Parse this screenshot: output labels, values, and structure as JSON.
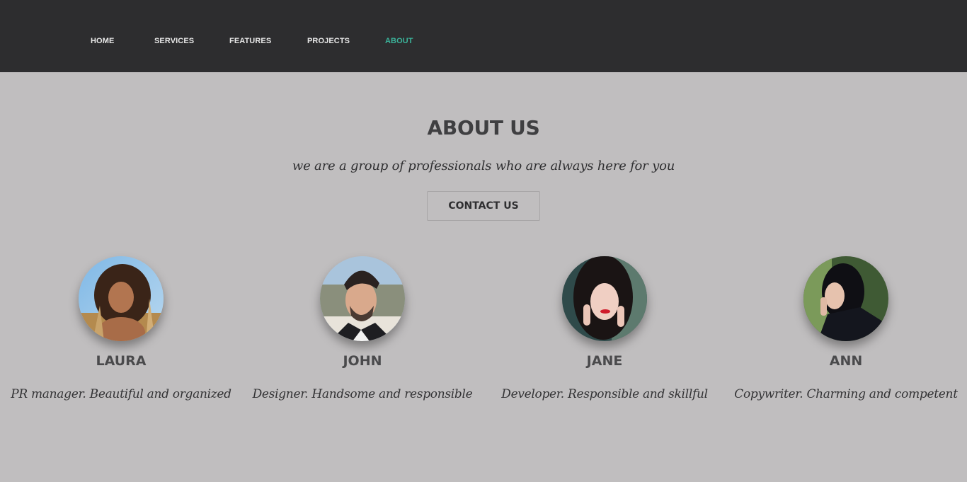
{
  "nav": {
    "items": [
      {
        "label": "HOME",
        "active": false
      },
      {
        "label": "SERVICES",
        "active": false
      },
      {
        "label": "FEATURES",
        "active": false
      },
      {
        "label": "PROJECTS",
        "active": false
      },
      {
        "label": "ABOUT",
        "active": true
      }
    ],
    "active_color": "#3bb39a"
  },
  "about": {
    "title": "ABOUT US",
    "tagline": "we are a group of professionals who are always here for you",
    "contact_label": "CONTACT US"
  },
  "team": [
    {
      "name": "LAURA",
      "description": "PR manager. Beautiful and organized"
    },
    {
      "name": "JOHN",
      "description": "Designer. Handsome and responsible"
    },
    {
      "name": "JANE",
      "description": "Developer. Responsible and skillful"
    },
    {
      "name": "ANN",
      "description": "Copywriter. Charming and competent"
    }
  ],
  "colors": {
    "header_bg": "#2d2d2f",
    "page_bg": "#c0bebf",
    "accent": "#3bb39a"
  }
}
